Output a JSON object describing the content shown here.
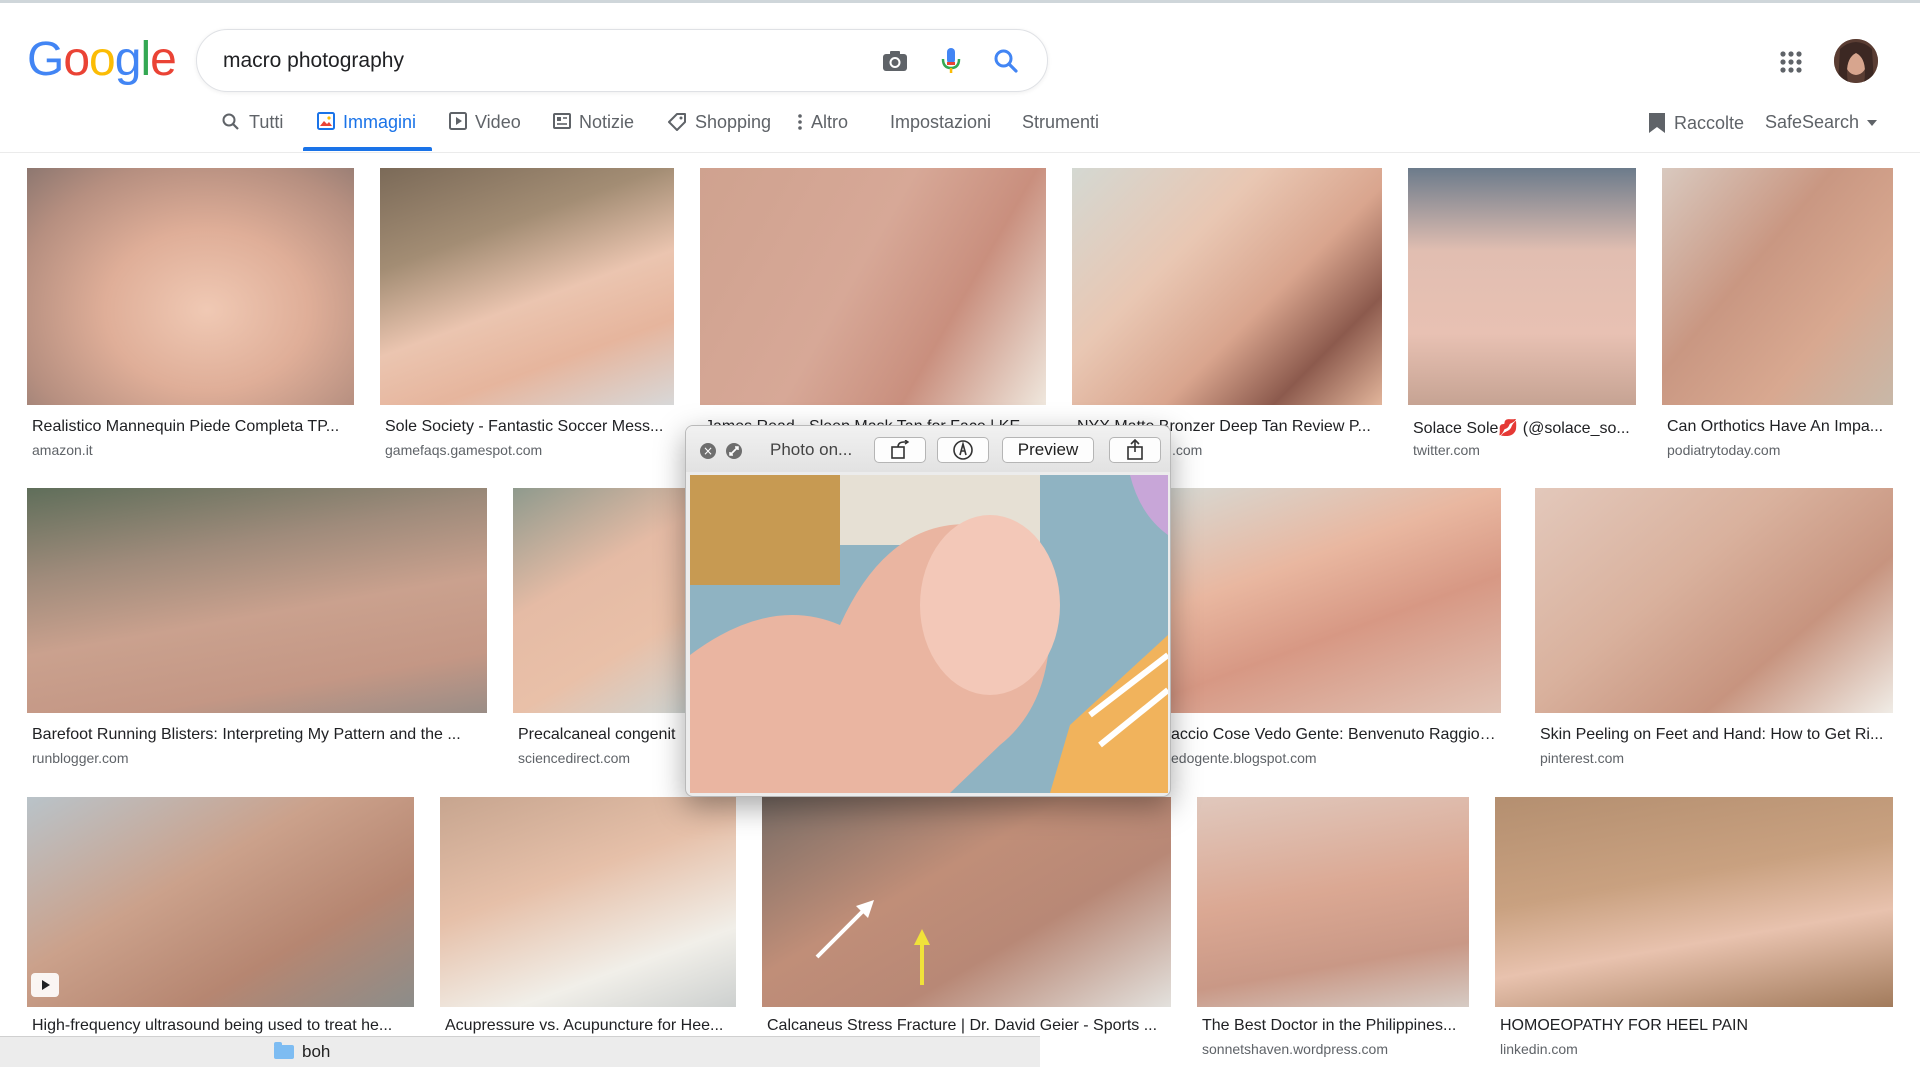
{
  "search": {
    "query": "macro photography"
  },
  "tabs": [
    {
      "label": "Tutti"
    },
    {
      "label": "Immagini"
    },
    {
      "label": "Video"
    },
    {
      "label": "Notizie"
    },
    {
      "label": "Shopping"
    },
    {
      "label": "Altro"
    },
    {
      "label": "Impostazioni"
    },
    {
      "label": "Strumenti"
    }
  ],
  "tools": {
    "collections": "Raccolte",
    "safesearch": "SafeSearch"
  },
  "results": [
    {
      "title": "Realistico Mannequin Piede Completa TP...",
      "source": "amazon.it"
    },
    {
      "title": "Sole Society - Fantastic Soccer Mess...",
      "source": "gamefaqs.gamespot.com"
    },
    {
      "title": "James Read - Sleep Mask Tan for Face | KE...",
      "source": ""
    },
    {
      "title": "NYX Matte Bronzer Deep Tan Review P...",
      "source": ".com"
    },
    {
      "title": "Solace Sole💋 (@solace_so...",
      "source": "twitter.com"
    },
    {
      "title": "Can Orthotics Have An Impa...",
      "source": "podiatrytoday.com"
    },
    {
      "title": "Barefoot Running Blisters: Interpreting My Pattern and the ...",
      "source": "runblogger.com"
    },
    {
      "title": "Precalcaneal congenit",
      "source": "sciencedirect.com"
    },
    {
      "title": "accio Cose Vedo Gente: Benvenuto Raggio ...",
      "source": "edogente.blogspot.com"
    },
    {
      "title": "Skin Peeling on Feet and Hand: How to Get Ri...",
      "source": "pinterest.com"
    },
    {
      "title": "High-frequency ultrasound being used to treat he...",
      "source": ""
    },
    {
      "title": "Acupressure vs. Acupuncture for Hee...",
      "source": ""
    },
    {
      "title": "Calcaneus Stress Fracture | Dr. David Geier - Sports ...",
      "source": ""
    },
    {
      "title": "The Best Doctor in the Philippines...",
      "source": "sonnetshaven.wordpress.com"
    },
    {
      "title": "HOMOEOPATHY FOR HEEL PAIN",
      "source": "linkedin.com"
    }
  ],
  "quicklook": {
    "title": "Photo on...",
    "preview_label": "Preview"
  },
  "finder": {
    "folder": "boh"
  },
  "colors": {
    "accent": "#1a73e8",
    "text": "#202124",
    "muted": "#5f6368"
  }
}
